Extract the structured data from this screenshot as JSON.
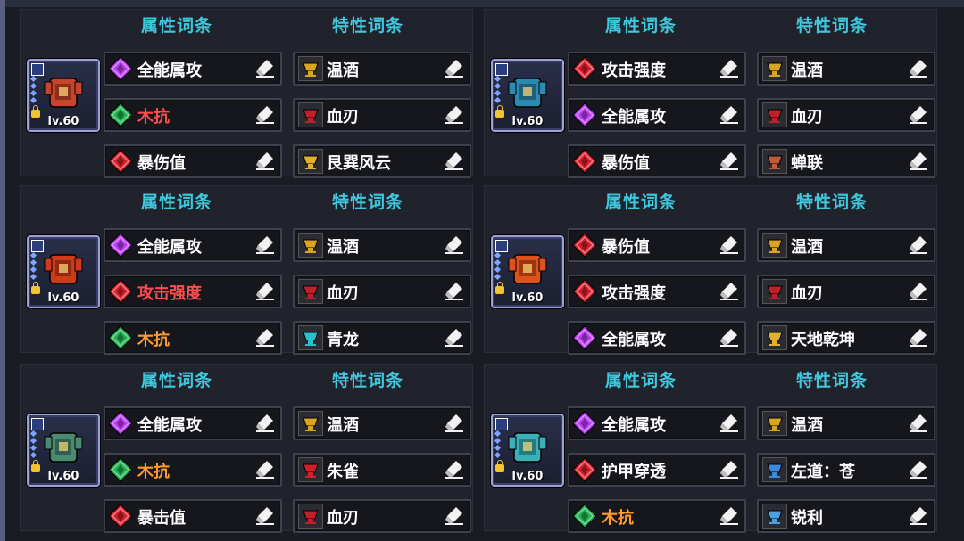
{
  "headers": {
    "attr": "属性词条",
    "trait": "特性词条"
  },
  "colors": {
    "header": "#3fc7de",
    "purple": "#b93cf0",
    "red": "#d4202c",
    "green": "#20b050",
    "text_red": "#ff4d4d",
    "text_orange": "#ff9a2e"
  },
  "panels": [
    {
      "level": "lv.60",
      "gear_icon": "armor-red-icon",
      "attrs": [
        {
          "label": "全能属攻",
          "gem": "purple",
          "tone": "white"
        },
        {
          "label": "木抗",
          "gem": "green",
          "tone": "red"
        },
        {
          "label": "暴伤值",
          "gem": "red",
          "tone": "white"
        }
      ],
      "traits": [
        {
          "label": "温酒",
          "icon": "wine-cup-icon",
          "color": "#d9a520"
        },
        {
          "label": "血刃",
          "icon": "blood-blade-icon",
          "color": "#c0202a"
        },
        {
          "label": "艮巽风云",
          "icon": "trigram-icon",
          "color": "#e0b030"
        }
      ]
    },
    {
      "level": "lv.60",
      "gear_icon": "necklace-icon",
      "attrs": [
        {
          "label": "攻击强度",
          "gem": "red",
          "tone": "white"
        },
        {
          "label": "全能属攻",
          "gem": "purple",
          "tone": "white"
        },
        {
          "label": "暴伤值",
          "gem": "red",
          "tone": "white"
        }
      ],
      "traits": [
        {
          "label": "温酒",
          "icon": "wine-cup-icon",
          "color": "#d9a520"
        },
        {
          "label": "血刃",
          "icon": "blood-blade-icon",
          "color": "#c0202a"
        },
        {
          "label": "蝉联",
          "icon": "cicada-icon",
          "color": "#c05a3a"
        }
      ]
    },
    {
      "level": "lv.60",
      "gear_icon": "armor-fire-icon",
      "attrs": [
        {
          "label": "全能属攻",
          "gem": "purple",
          "tone": "white"
        },
        {
          "label": "攻击强度",
          "gem": "red",
          "tone": "red"
        },
        {
          "label": "木抗",
          "gem": "green",
          "tone": "orange"
        }
      ],
      "traits": [
        {
          "label": "温酒",
          "icon": "wine-cup-icon",
          "color": "#d9a520"
        },
        {
          "label": "血刃",
          "icon": "blood-blade-icon",
          "color": "#c0202a"
        },
        {
          "label": "青龙",
          "icon": "azure-dragon-icon",
          "color": "#2ac0c8"
        }
      ]
    },
    {
      "level": "lv.60",
      "gear_icon": "fire-amulet-icon",
      "attrs": [
        {
          "label": "暴伤值",
          "gem": "red",
          "tone": "white"
        },
        {
          "label": "攻击强度",
          "gem": "red",
          "tone": "white"
        },
        {
          "label": "全能属攻",
          "gem": "purple",
          "tone": "white"
        }
      ],
      "traits": [
        {
          "label": "温酒",
          "icon": "wine-cup-icon",
          "color": "#d9a520"
        },
        {
          "label": "血刃",
          "icon": "blood-blade-icon",
          "color": "#c0202a"
        },
        {
          "label": "天地乾坤",
          "icon": "heaven-earth-icon",
          "color": "#e0b030"
        }
      ]
    },
    {
      "level": "lv.60",
      "gear_icon": "winged-gem-icon",
      "attrs": [
        {
          "label": "全能属攻",
          "gem": "purple",
          "tone": "white"
        },
        {
          "label": "木抗",
          "gem": "green",
          "tone": "orange"
        },
        {
          "label": "暴击值",
          "gem": "red",
          "tone": "white"
        }
      ],
      "traits": [
        {
          "label": "温酒",
          "icon": "wine-cup-icon",
          "color": "#d9a520"
        },
        {
          "label": "朱雀",
          "icon": "vermilion-bird-icon",
          "color": "#d0202a"
        },
        {
          "label": "血刃",
          "icon": "blood-blade-icon",
          "color": "#c0202a"
        }
      ]
    },
    {
      "level": "lv.60",
      "gear_icon": "gauntlet-icon",
      "attrs": [
        {
          "label": "全能属攻",
          "gem": "purple",
          "tone": "white"
        },
        {
          "label": "护甲穿透",
          "gem": "red",
          "tone": "white"
        },
        {
          "label": "木抗",
          "gem": "green",
          "tone": "orange"
        }
      ],
      "traits": [
        {
          "label": "温酒",
          "icon": "wine-cup-icon",
          "color": "#d9a520"
        },
        {
          "label": "左道：苍",
          "icon": "left-path-icon",
          "color": "#3a8ad8"
        },
        {
          "label": "锐利",
          "icon": "sharp-blade-icon",
          "color": "#4aa0e0"
        }
      ]
    }
  ]
}
